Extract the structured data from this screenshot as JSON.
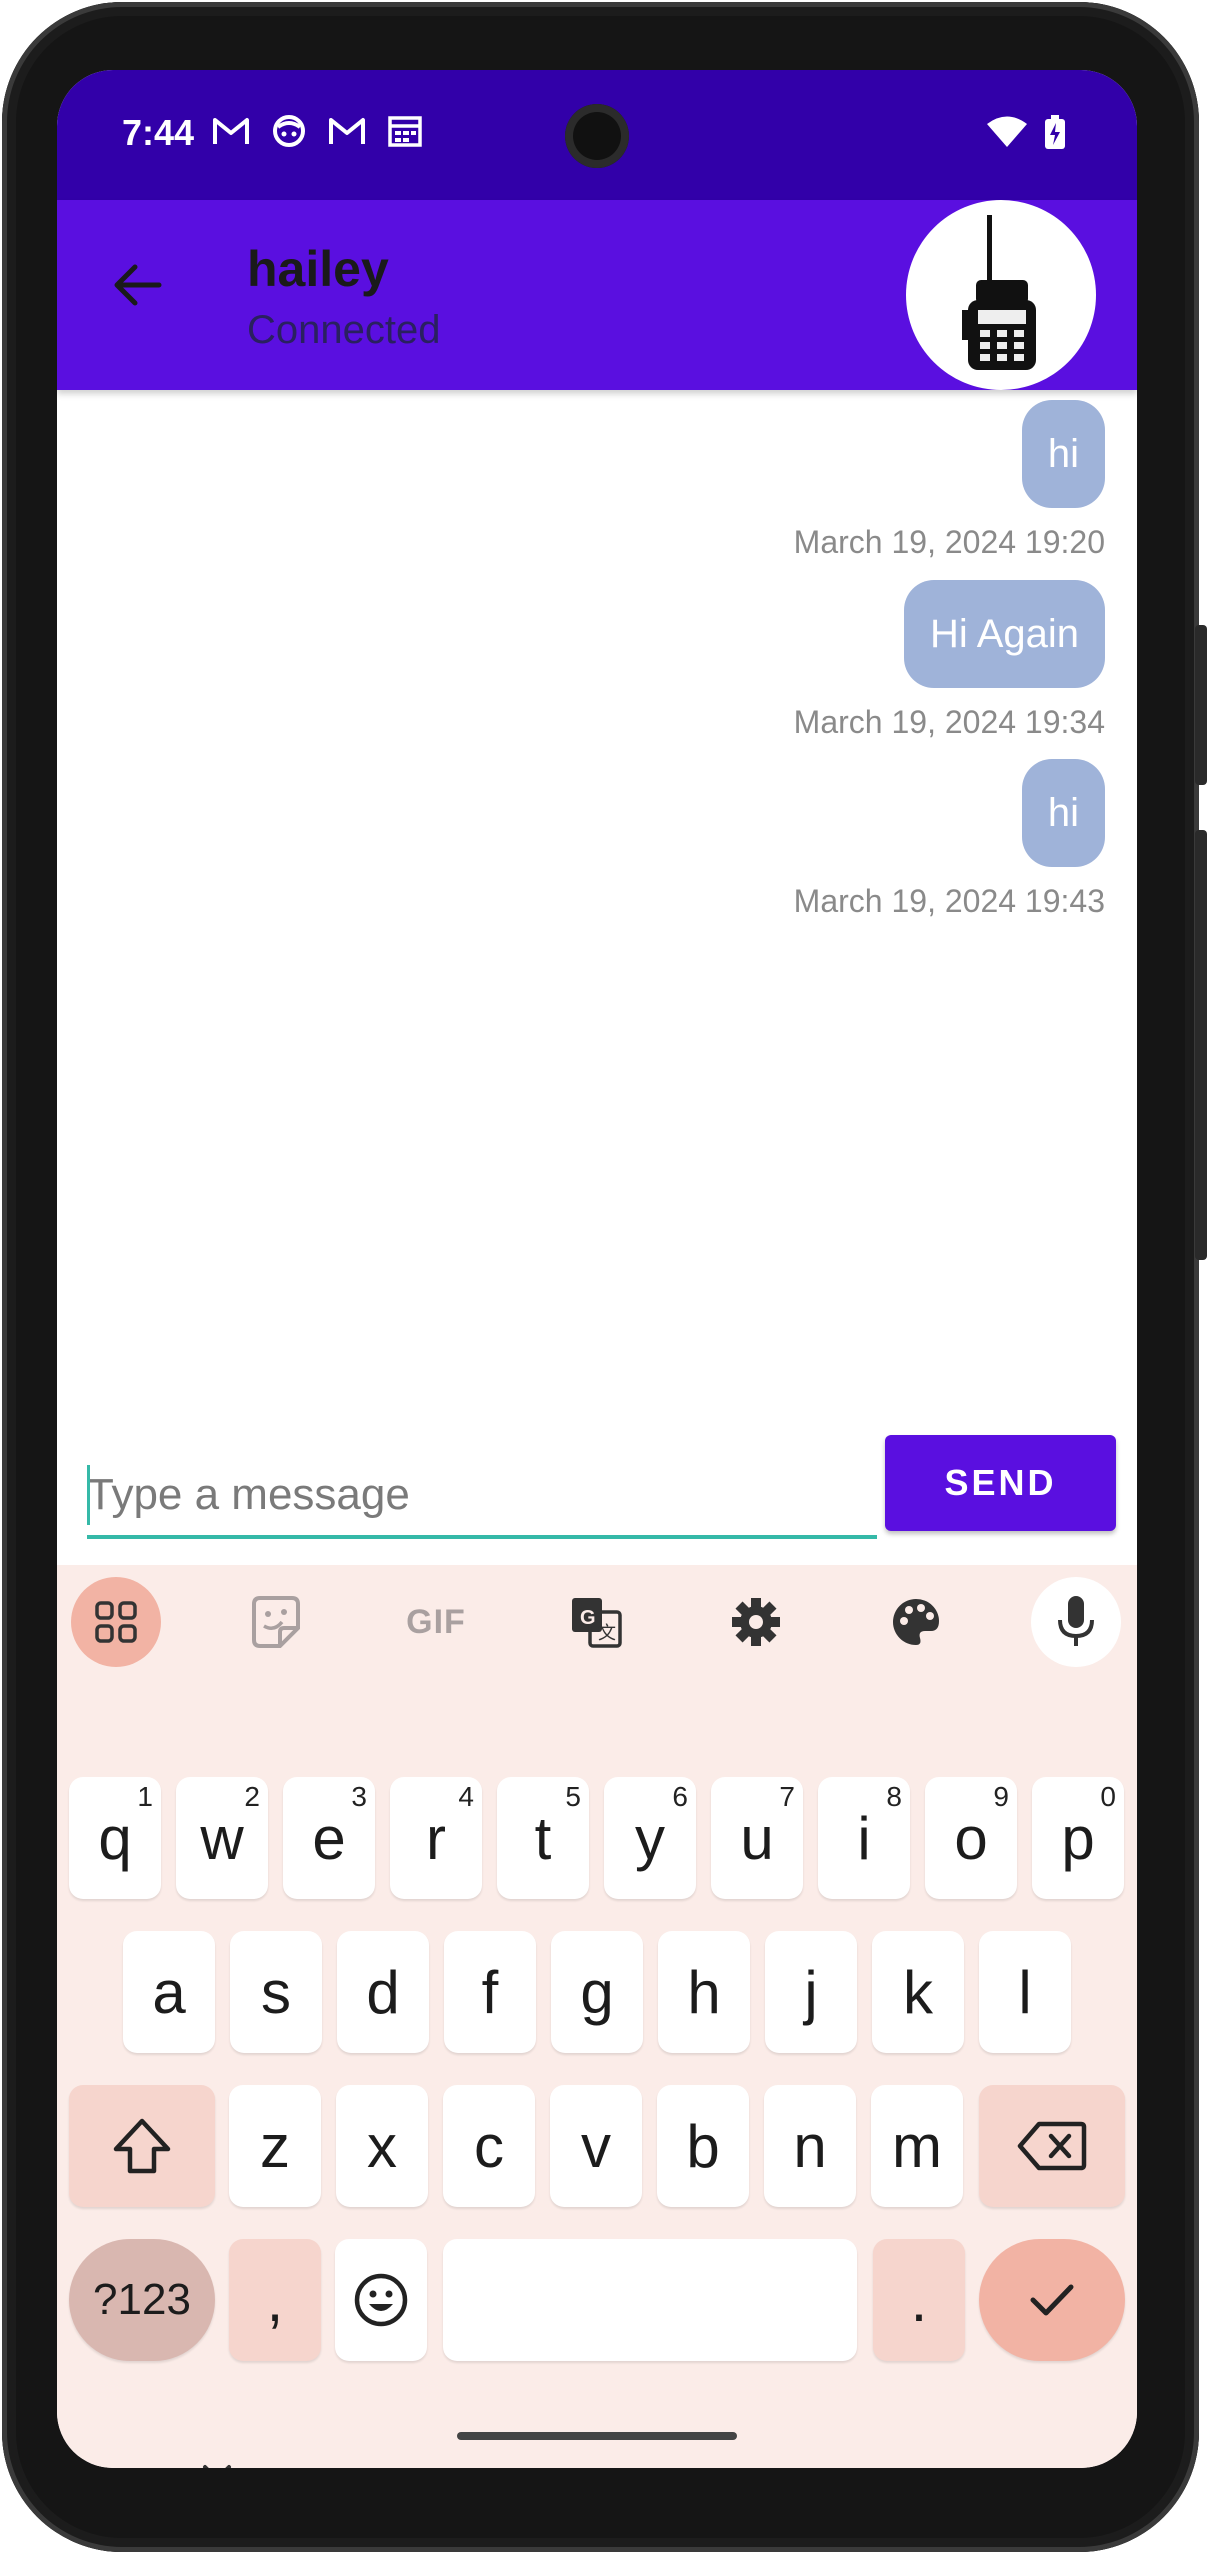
{
  "status_bar": {
    "time": "7:44"
  },
  "app_bar": {
    "title": "hailey",
    "subtitle": "Connected"
  },
  "messages": [
    {
      "text": "hi",
      "timestamp": "March 19, 2024 19:20"
    },
    {
      "text": "Hi Again",
      "timestamp": "March 19, 2024 19:34"
    },
    {
      "text": "hi",
      "timestamp": "March 19, 2024 19:43"
    }
  ],
  "composer": {
    "placeholder": "Type a message",
    "send_label": "SEND"
  },
  "keyboard": {
    "toolbar": [
      "apps-grid-icon",
      "sticker-icon",
      "gif-icon",
      "translate-icon",
      "settings-gear-icon",
      "palette-icon",
      "microphone-icon"
    ],
    "gif_label": "GIF",
    "row1": [
      {
        "k": "q",
        "n": "1"
      },
      {
        "k": "w",
        "n": "2"
      },
      {
        "k": "e",
        "n": "3"
      },
      {
        "k": "r",
        "n": "4"
      },
      {
        "k": "t",
        "n": "5"
      },
      {
        "k": "y",
        "n": "6"
      },
      {
        "k": "u",
        "n": "7"
      },
      {
        "k": "i",
        "n": "8"
      },
      {
        "k": "o",
        "n": "9"
      },
      {
        "k": "p",
        "n": "0"
      }
    ],
    "row2": [
      "a",
      "s",
      "d",
      "f",
      "g",
      "h",
      "j",
      "k",
      "l"
    ],
    "row3": [
      "z",
      "x",
      "c",
      "v",
      "b",
      "n",
      "m"
    ],
    "symbols_label": "?123",
    "comma_label": ",",
    "period_label": "."
  }
}
